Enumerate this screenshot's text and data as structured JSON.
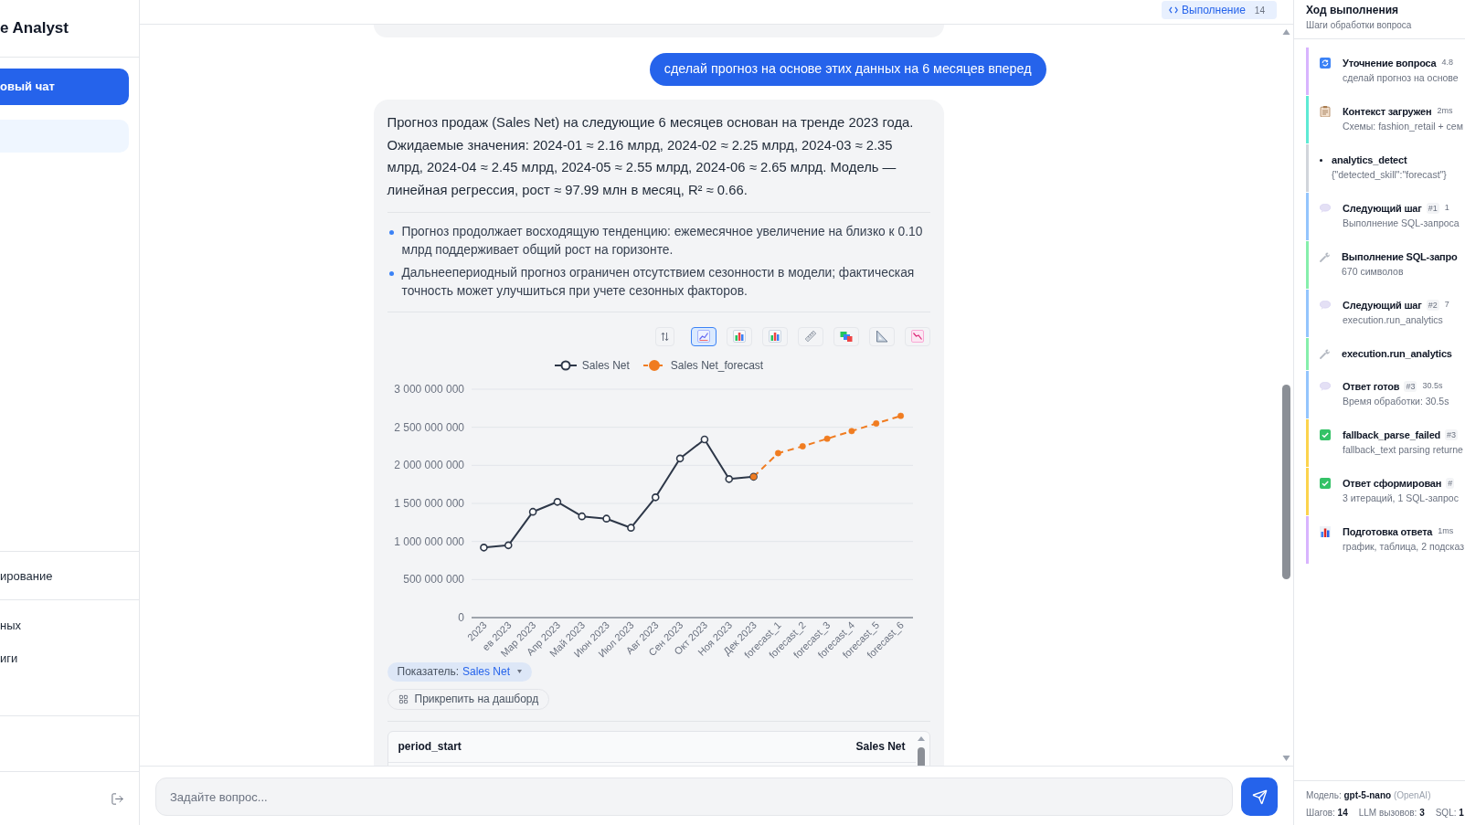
{
  "sidebar": {
    "brand": "e Analyst",
    "new_chat": "овый чат",
    "chats": [
      {
        "selected": true
      }
    ],
    "nav_groups": [
      {
        "items": [
          {
            "label": "ирование"
          }
        ]
      },
      {
        "items": [
          {
            "label": "ных"
          },
          {
            "label": "иги"
          }
        ]
      }
    ]
  },
  "topbar": {
    "execution": {
      "label": "Выполнение",
      "count": "14"
    }
  },
  "messages": [
    {
      "kind": "assistant"
    },
    {
      "kind": "user",
      "text": "сделай прогноз на основе этих данных на 6 месяцев вперед"
    },
    {
      "kind": "assistant",
      "text": "Прогноз продаж (Sales Net) на следующие 6 месяцев основан на тренде 2023 года. Ожидаемые значения: 2024-01 ≈ 2.16 млрд, 2024-02 ≈ 2.25 млрд, 2024-03 ≈ 2.35 млрд, 2024-04 ≈ 2.45 млрд, 2024-05 ≈ 2.55 млрд, 2024-06 ≈ 2.65 млрд. Модель — линейная регрессия, рост ≈ 97.99 млн в месяц, R² ≈ 0.66.",
      "bullets": [
        "Прогноз продолжает восходящую тенденцию: ежемесячное увеличение на близко к 0.10 млрд поддерживает общий рост на горизонте.",
        "Дальнеепериодный прогноз ограничен отсутствием сезонности в модели; фактическая точность может улучшиться при учете сезонных факторов."
      ],
      "chart_types": [
        {
          "kind": "line",
          "selected": true
        },
        {
          "kind": "bar",
          "selected": false
        },
        {
          "kind": "bar",
          "selected": false
        },
        {
          "kind": "ruler",
          "selected": false
        },
        {
          "kind": "blocks",
          "selected": false
        },
        {
          "kind": "triangle",
          "selected": false
        },
        {
          "kind": "decline",
          "selected": false
        }
      ],
      "chart_data": {
        "type": "line",
        "legend": "top",
        "grid": true,
        "categories": [
          "2023",
          "ев 2023",
          "Мар 2023",
          "Апр 2023",
          "Май 2023",
          "Июн 2023",
          "Июл 2023",
          "Авг 2023",
          "Сен 2023",
          "Окт 2023",
          "Ноя 2023",
          "Дек 2023",
          "forecast_1",
          "forecast_2",
          "forecast_3",
          "forecast_4",
          "forecast_5",
          "forecast_6"
        ],
        "ylim": [
          0,
          3000000000
        ],
        "yticks": [
          {
            "value": 0,
            "label": "0"
          },
          {
            "value": 500000000,
            "label": "500 000 000"
          },
          {
            "value": 1000000000,
            "label": "1 000 000 000"
          },
          {
            "value": 1500000000,
            "label": "1 500 000 000"
          },
          {
            "value": 2000000000,
            "label": "2 000 000 000"
          },
          {
            "value": 2500000000,
            "label": "2 500 000 000"
          },
          {
            "value": 3000000000,
            "label": "3 000 000 000"
          }
        ],
        "series": [
          {
            "name": "Sales Net",
            "color": "#2d3748",
            "marker": "circle",
            "values": [
              920000000,
              950000000,
              1390000000,
              1520000000,
              1330000000,
              1300000000,
              1180000000,
              1580000000,
              2090000000,
              2340000000,
              1820000000,
              1850000000,
              null,
              null,
              null,
              null,
              null,
              null
            ]
          },
          {
            "name": "Sales Net_forecast",
            "color": "#f07c21",
            "marker": "circle",
            "line_style": "dashed",
            "values": [
              null,
              null,
              null,
              null,
              null,
              null,
              null,
              null,
              null,
              null,
              null,
              1850000000,
              2160000000,
              2250000000,
              2350000000,
              2450000000,
              2550000000,
              2650000000
            ]
          }
        ]
      },
      "metric": {
        "label": "Показатель:",
        "value": "Sales Net"
      },
      "pin_button": "Прикрепить на дашборд",
      "table": {
        "columns": [
          "period_start",
          "Sales Net"
        ]
      }
    }
  ],
  "composer": {
    "placeholder": "Задайте вопрос..."
  },
  "execution_panel": {
    "title": "Ход выполнения",
    "subtitle": "Шаги обработки вопроса",
    "steps": [
      {
        "kind": "clarify",
        "color": "#d8b4fe",
        "title": "Уточнение вопроса",
        "time": "4.8",
        "detail": "сделай прогноз на основе"
      },
      {
        "kind": "context",
        "color": "#5eead4",
        "title": "Контекст загружен",
        "time": "2ms",
        "detail": "Схемы: fashion_retail + сем"
      },
      {
        "kind": "detect",
        "color": "#d1d5db",
        "title": "analytics_detect",
        "detail": "{\"detected_skill\":\"forecast\"}"
      },
      {
        "kind": "llm",
        "color": "#93c5fd",
        "title": "Следующий шаг",
        "badge": "#1",
        "time": "1",
        "detail": "Выполнение SQL-запроса"
      },
      {
        "kind": "tool",
        "color": "#86efac",
        "title": "Выполнение SQL-запро",
        "detail": "670 символов"
      },
      {
        "kind": "llm",
        "color": "#93c5fd",
        "title": "Следующий шаг",
        "badge": "#2",
        "time": "7",
        "detail": "execution.run_analytics"
      },
      {
        "kind": "tool",
        "color": "#86efac",
        "title": "execution.run_analytics"
      },
      {
        "kind": "llm",
        "color": "#93c5fd",
        "title": "Ответ готов",
        "badge": "#3",
        "time": "30.5s",
        "detail": "Время обработки: 30.5s"
      },
      {
        "kind": "check",
        "color": "#fcd34d",
        "title": "fallback_parse_failed",
        "badge": "#3",
        "detail": "fallback_text parsing returne"
      },
      {
        "kind": "check",
        "color": "#fcd34d",
        "title": "Ответ сформирован",
        "badge": "#",
        "detail": "3 итераций, 1 SQL-запрос"
      },
      {
        "kind": "chart",
        "color": "#d8b4fe",
        "title": "Подготовка ответа",
        "time": "1ms",
        "detail": "график, таблица, 2 подсказ"
      }
    ],
    "footer": {
      "model_label": "Модель:",
      "model": "gpt-5-nano",
      "provider": "(OpenAI)",
      "stats": [
        {
          "label": "Шагов:",
          "value": "14"
        },
        {
          "label": "LLM вызовов:",
          "value": "3"
        },
        {
          "label": "SQL:",
          "value": "1"
        }
      ]
    }
  }
}
